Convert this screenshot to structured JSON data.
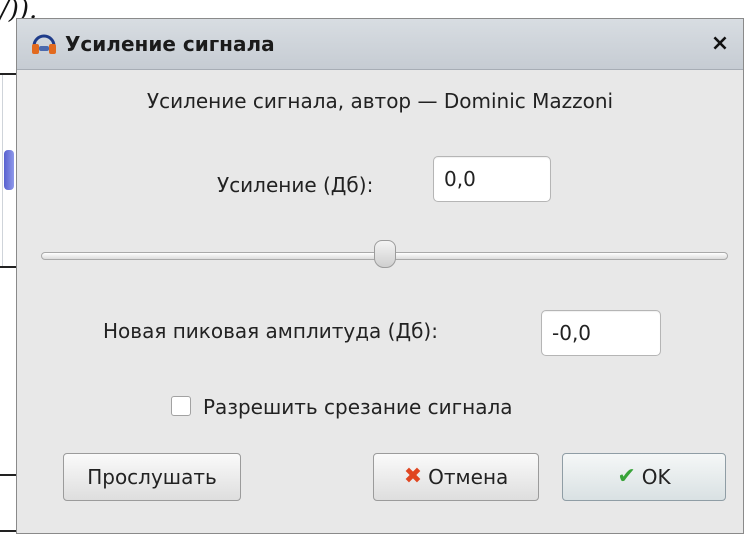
{
  "background": {
    "snippet": "/))."
  },
  "dialog": {
    "title": "Усиление сигнала",
    "title_icon": "headphones-icon",
    "close_label": "×",
    "header": "Усиление сигнала, автор — Dominic Mazzoni"
  },
  "gain": {
    "label": "Усиление (Дб):",
    "value": "0,0"
  },
  "slider": {
    "level": 0.5
  },
  "peak": {
    "label": "Новая пиковая амплитуда (Дб):",
    "value": "-0,0"
  },
  "clipping": {
    "label": "Разрешить срезание сигнала",
    "checked": false
  },
  "buttons": {
    "preview": "Прослушать",
    "cancel": "Отмена",
    "ok": "OK",
    "cancel_icon": "x-icon",
    "ok_icon": "checkmark-icon"
  },
  "colors": {
    "dialog_bg": "#e8e8e8",
    "titlebar": "#cbd1d8",
    "cancel_icon": "#e04621",
    "ok_icon": "#39a339"
  }
}
